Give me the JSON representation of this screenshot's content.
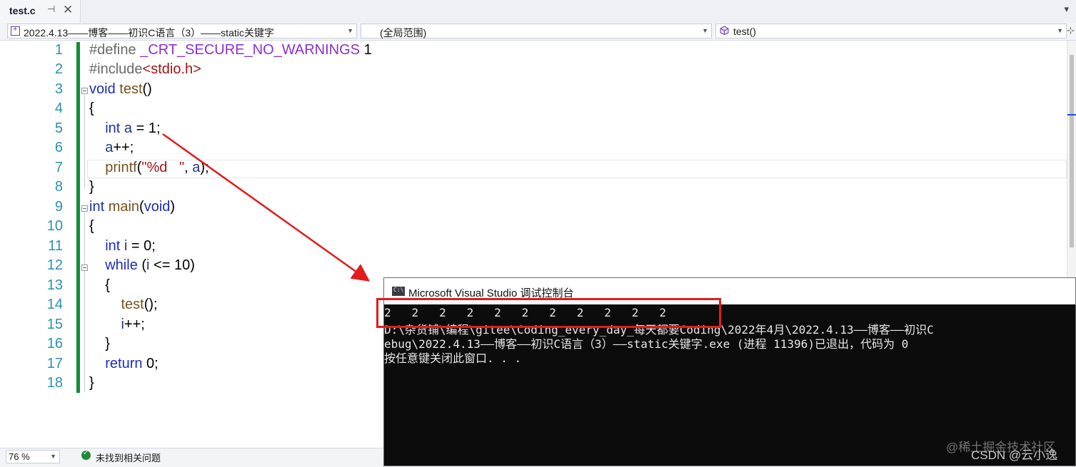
{
  "tab": {
    "title": "test.c",
    "pin_icon": "pin-icon",
    "close_icon": "close-icon"
  },
  "navbar": {
    "project": "2022.4.13——博客——初识C语言（3）——static关键字",
    "scope": "(全局范围)",
    "member": "test()"
  },
  "code_lines": [
    {
      "num": "1"
    },
    {
      "num": "2"
    },
    {
      "num": "3"
    },
    {
      "num": "4"
    },
    {
      "num": "5"
    },
    {
      "num": "6"
    },
    {
      "num": "7"
    },
    {
      "num": "8"
    },
    {
      "num": "9"
    },
    {
      "num": "10"
    },
    {
      "num": "11"
    },
    {
      "num": "12"
    },
    {
      "num": "13"
    },
    {
      "num": "14"
    },
    {
      "num": "15"
    },
    {
      "num": "16"
    },
    {
      "num": "17"
    },
    {
      "num": "18"
    }
  ],
  "code": {
    "l1a": "#define ",
    "l1b": "_CRT_SECURE_NO_WARNINGS",
    "l1c": " 1",
    "l2a": "#include",
    "l2b": "<stdio.h>",
    "l3a": "void",
    "l3b": " ",
    "l3c": "test",
    "l3d": "()",
    "l4": "{",
    "l5a": "    ",
    "l5b": "int",
    "l5c": " ",
    "l5d": "a",
    "l5e": " = 1;",
    "l6a": "    ",
    "l6b": "a",
    "l6c": "++;",
    "l7a": "    ",
    "l7b": "printf",
    "l7c": "(",
    "l7d": "\"%d   \"",
    "l7e": ", ",
    "l7f": "a",
    "l7g": ");",
    "l8": "}",
    "l9a": "int",
    "l9b": " ",
    "l9c": "main",
    "l9d": "(",
    "l9e": "void",
    "l9f": ")",
    "l10": "{",
    "l11a": "    ",
    "l11b": "int",
    "l11c": " ",
    "l11d": "i",
    "l11e": " = 0;",
    "l12a": "    ",
    "l12b": "while",
    "l12c": " (",
    "l12d": "i",
    "l12e": " <= 10)",
    "l13": "    {",
    "l14a": "        ",
    "l14b": "test",
    "l14c": "();",
    "l15a": "        ",
    "l15b": "i",
    "l15c": "++;",
    "l16": "    }",
    "l17a": "    ",
    "l17b": "return",
    "l17c": " 0;",
    "l18": "}"
  },
  "status": {
    "zoom": "76 %",
    "issues": "未找到相关问题"
  },
  "console": {
    "title": "Microsoft Visual Studio 调试控制台",
    "line1": "2   2   2   2   2   2   2   2   2   2   2",
    "line2": "D:\\杂货铺\\编程\\gitee\\Coding_every_day_每天都要Coding\\2022年4月\\2022.4.13——博客——初识C",
    "line3": "ebug\\2022.4.13——博客——初识C语言（3）——static关键字.exe (进程 11396)已退出，代码为 0",
    "line4": "按任意键关闭此窗口. . ."
  },
  "watermark": {
    "line1": "@稀土掘金技术社区",
    "line2": "CSDN @云小逸"
  },
  "colors": {
    "keyword": "#1d2fb8",
    "macro": "#8c2fd0",
    "string": "#a31515",
    "function": "#74531f",
    "change_bar": "#108f36",
    "annotation": "#e31b1b"
  }
}
